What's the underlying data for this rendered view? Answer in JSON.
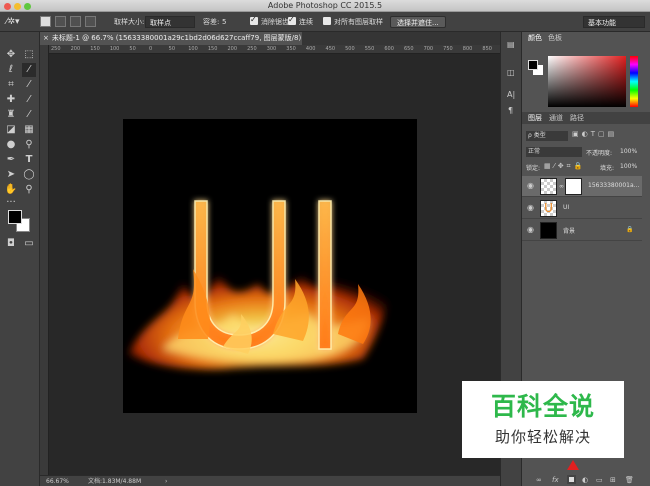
{
  "app_title": "Adobe Photoshop CC 2015.5",
  "options_bar": {
    "sample_size_label": "取样大小:",
    "sample_size_value": "取样点",
    "tolerance_label": "容差:",
    "tolerance_value": "5",
    "anti_alias_label": "消除锯齿",
    "contiguous_label": "连续",
    "sample_all_layers_label": "对所有图层取样",
    "select_and_mask_label": "选择并遮住...",
    "workspace_value": "基本功能"
  },
  "document": {
    "tab_title": "未标题-1 @ 66.7% (15633380001a29c1bd2d06d627ccaff79, 图层蒙版/8) *",
    "canvas_text": "U"
  },
  "rulers": {
    "h_ticks": [
      "250",
      "200",
      "150",
      "100",
      "50",
      "0",
      "50",
      "100",
      "150",
      "200",
      "250",
      "300",
      "350",
      "400",
      "450",
      "500",
      "550",
      "600",
      "650",
      "700",
      "750",
      "800",
      "850"
    ]
  },
  "status_bar": {
    "zoom": "66.67%",
    "doc_info": "文档:1.83M/4.88M"
  },
  "color_panel": {
    "tabs": [
      "颜色",
      "色板"
    ]
  },
  "layers_panel": {
    "tabs": [
      "图层",
      "通道",
      "路径"
    ],
    "filter_label": "ρ 类型",
    "blend_mode": "正常",
    "opacity_label": "不透明度:",
    "opacity_value": "100%",
    "lock_label": "锁定:",
    "fill_label": "填充:",
    "fill_value": "100%",
    "layers": [
      {
        "name": "15633380001a...",
        "selected": true
      },
      {
        "name": "UI",
        "selected": false
      },
      {
        "name": "背景",
        "selected": false
      }
    ],
    "bottom_fx": "fx"
  },
  "watermark": {
    "main": "百科全说",
    "sub": "助你轻松解决"
  },
  "colors": {
    "accent_red": "#e02020",
    "watermark_green": "#2eb84b"
  }
}
